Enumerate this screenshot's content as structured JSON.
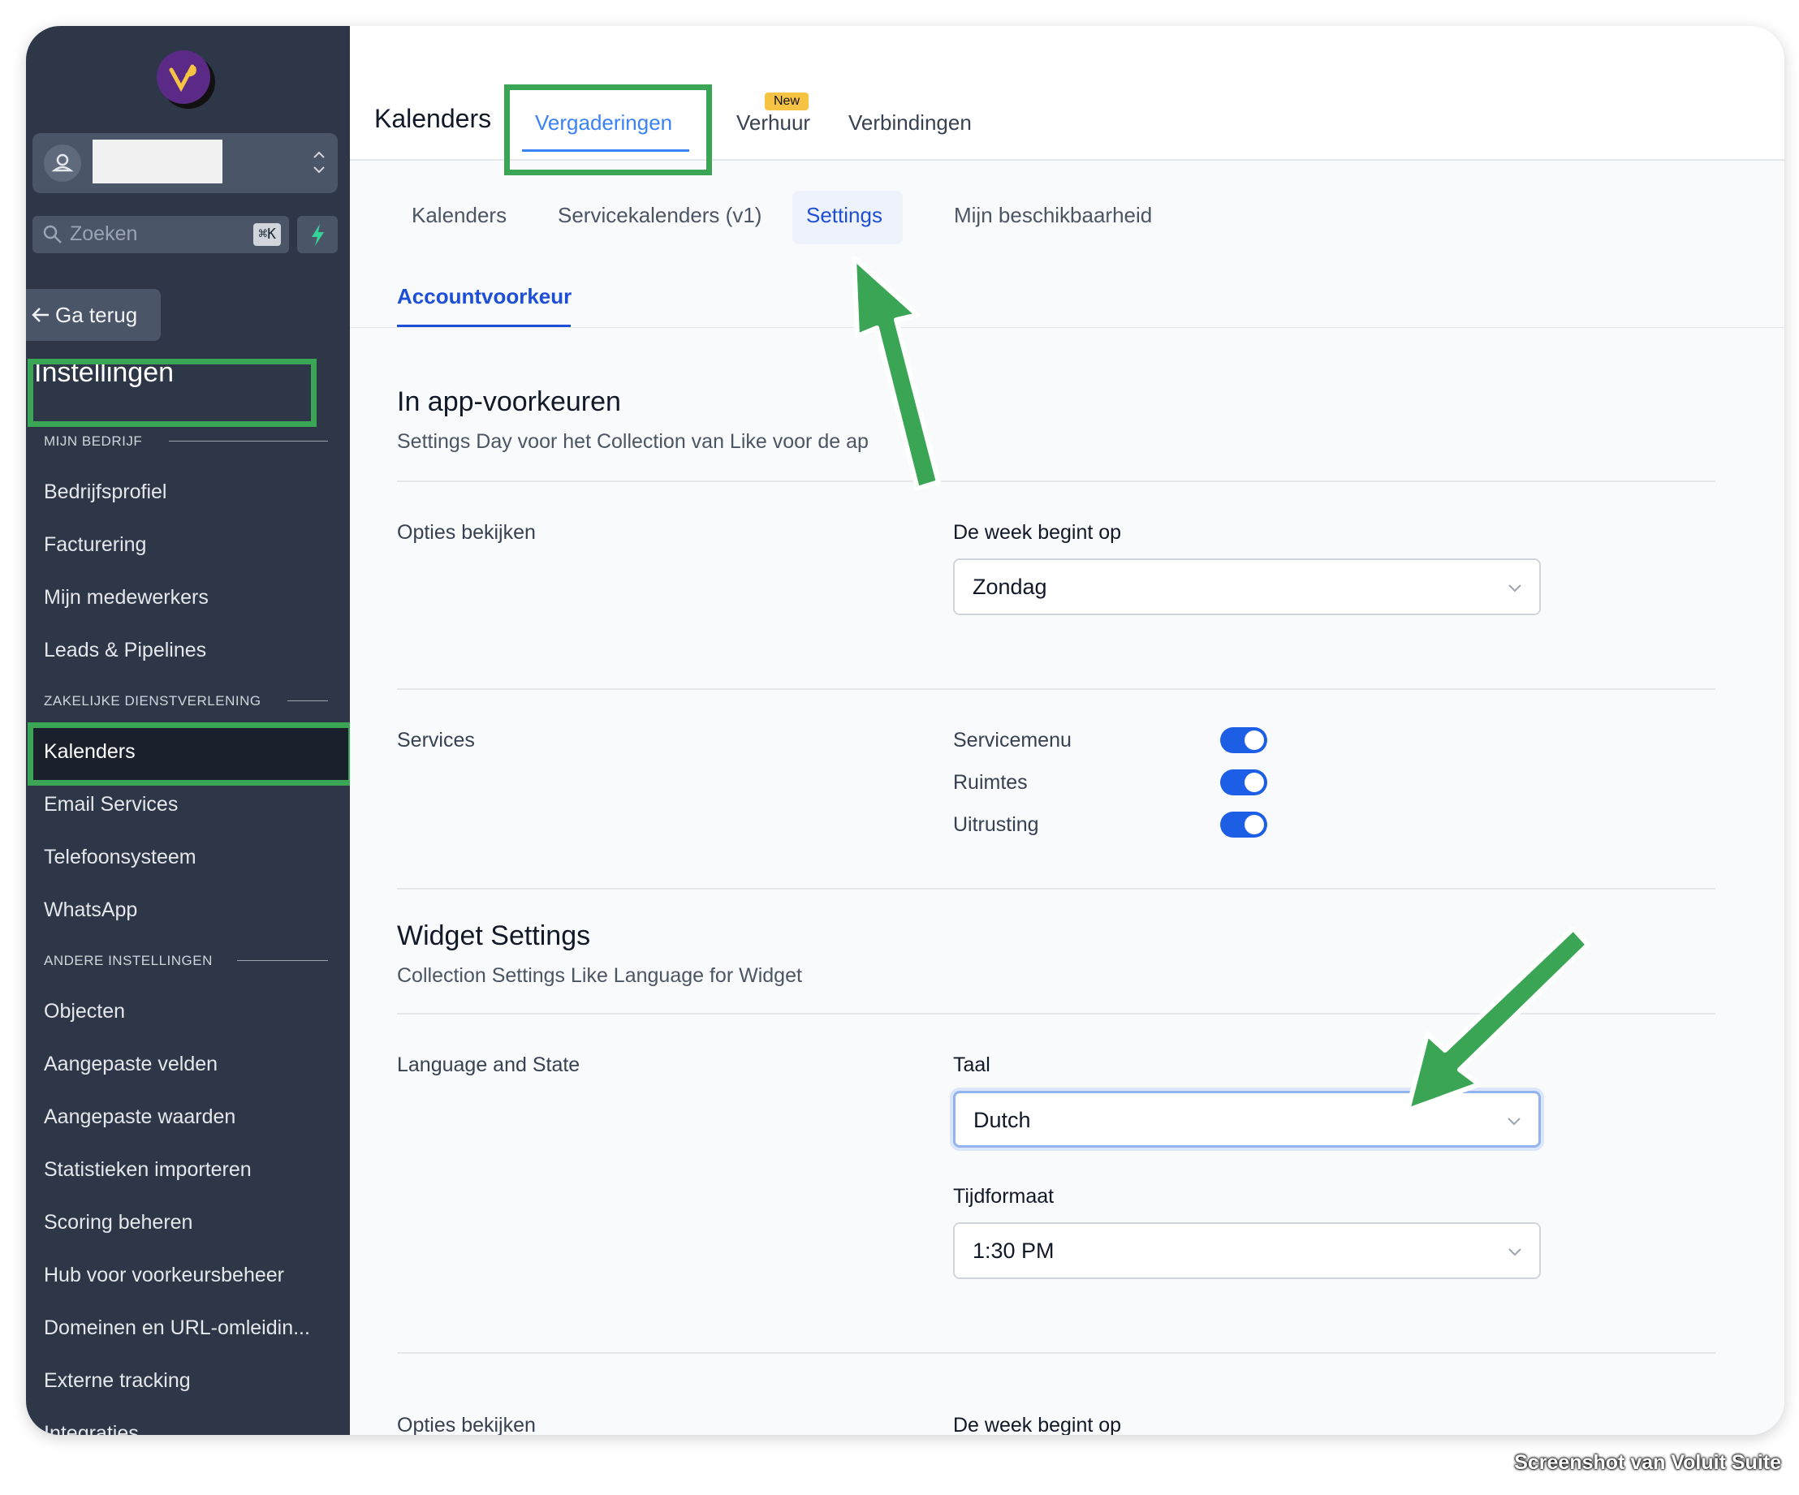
{
  "sidebar": {
    "search_placeholder": "Zoeken",
    "search_shortcut": "⌘K",
    "go_back": "Ga terug",
    "settings_title": "Instellingen",
    "sections": [
      {
        "label": "MIJN BEDRIJF",
        "items": [
          "Bedrijfsprofiel",
          "Facturering",
          "Mijn medewerkers",
          "Leads & Pipelines"
        ]
      },
      {
        "label": "ZAKELIJKE DIENSTVERLENING",
        "items": [
          "Kalenders",
          "Email Services",
          "Telefoonsysteem",
          "WhatsApp"
        ]
      },
      {
        "label": "ANDERE INSTELLINGEN",
        "items": [
          "Objecten",
          "Aangepaste velden",
          "Aangepaste waarden",
          "Statistieken importeren",
          "Scoring beheren",
          "Hub voor voorkeursbeheer",
          "Domeinen en URL-omleidin...",
          "Externe tracking",
          "Integraties"
        ]
      }
    ],
    "active_item": "Kalenders"
  },
  "header": {
    "title": "Kalenders",
    "tabs": [
      "Vergaderingen",
      "Verhuur",
      "Verbindingen"
    ],
    "active_tab": "Vergaderingen",
    "new_badge": "New"
  },
  "subtabs": {
    "items": [
      "Kalenders",
      "Servicekalenders (v1)",
      "Settings",
      "Mijn beschikbaarheid"
    ],
    "active": "Settings"
  },
  "account_tab": "Accountvoorkeur",
  "in_app": {
    "title": "In app-voorkeuren",
    "description": "Settings Day voor het Collection van Like voor de ap",
    "view_options_label": "Opties bekijken",
    "week_start_label": "De week begint op",
    "week_start_value": "Zondag"
  },
  "services": {
    "label": "Services",
    "toggles": [
      {
        "label": "Servicemenu",
        "on": true
      },
      {
        "label": "Ruimtes",
        "on": true
      },
      {
        "label": "Uitrusting",
        "on": true
      }
    ]
  },
  "widget": {
    "title": "Widget Settings",
    "description": "Collection Settings Like Language for Widget",
    "language_state_label": "Language and State",
    "language_label": "Taal",
    "language_value": "Dutch",
    "time_format_label": "Tijdformaat",
    "time_format_value": "1:30 PM"
  },
  "cutoff": {
    "left": "Opties bekijken",
    "right": "De week begint op"
  },
  "watermark": "Screenshot van Voluit Suite",
  "colors": {
    "sidebar_bg": "#2d3748",
    "accent": "#1d4ed8",
    "highlight": "#3aa655",
    "toggle_on": "#1d5ee6"
  }
}
